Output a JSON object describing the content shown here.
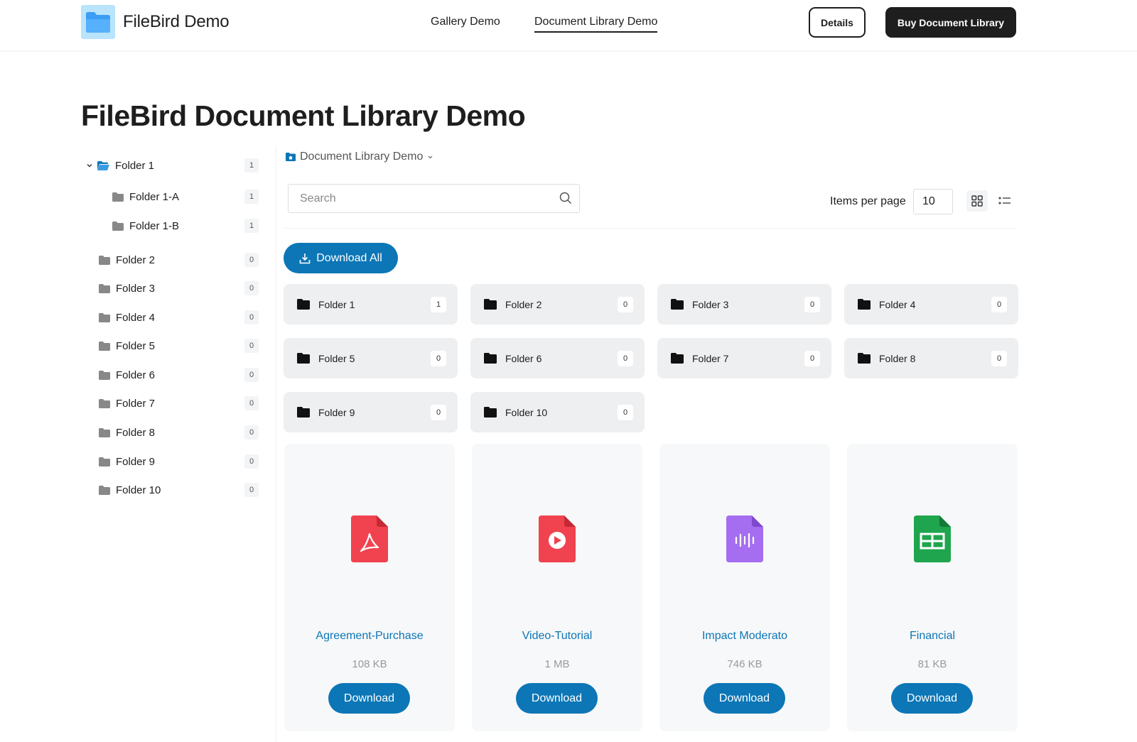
{
  "header": {
    "brand": "FileBird Demo",
    "nav": [
      "Gallery Demo",
      "Document Library Demo"
    ],
    "details_label": "Details",
    "buy_label": "Buy Document Library"
  },
  "page_title": "FileBird Document Library Demo",
  "sidebar": {
    "items": [
      {
        "label": "Folder 1",
        "count": "1"
      },
      {
        "label": "Folder 1-A",
        "count": "1"
      },
      {
        "label": "Folder 1-B",
        "count": "1"
      },
      {
        "label": "Folder 2",
        "count": "0"
      },
      {
        "label": "Folder 3",
        "count": "0"
      },
      {
        "label": "Folder 4",
        "count": "0"
      },
      {
        "label": "Folder 5",
        "count": "0"
      },
      {
        "label": "Folder 6",
        "count": "0"
      },
      {
        "label": "Folder 7",
        "count": "0"
      },
      {
        "label": "Folder 8",
        "count": "0"
      },
      {
        "label": "Folder 9",
        "count": "0"
      },
      {
        "label": "Folder 10",
        "count": "0"
      }
    ]
  },
  "toolbar": {
    "breadcrumb": "Document Library Demo",
    "search_placeholder": "Search",
    "items_per_page_label": "Items per page",
    "items_per_page_value": "10",
    "download_all_label": "Download All"
  },
  "folders": [
    {
      "label": "Folder 1",
      "count": "1"
    },
    {
      "label": "Folder 2",
      "count": "0"
    },
    {
      "label": "Folder 3",
      "count": "0"
    },
    {
      "label": "Folder 4",
      "count": "0"
    },
    {
      "label": "Folder 5",
      "count": "0"
    },
    {
      "label": "Folder 6",
      "count": "0"
    },
    {
      "label": "Folder 7",
      "count": "0"
    },
    {
      "label": "Folder 8",
      "count": "0"
    },
    {
      "label": "Folder 9",
      "count": "0"
    },
    {
      "label": "Folder 10",
      "count": "0"
    }
  ],
  "files": [
    {
      "name": "Agreement-Purchase",
      "size": "108 KB",
      "icon": "pdf-file-icon",
      "color": "#f0434f",
      "download_label": "Download"
    },
    {
      "name": "Video-Tutorial",
      "size": "1 MB",
      "icon": "video-file-icon",
      "color": "#f0434f",
      "download_label": "Download"
    },
    {
      "name": "Impact Moderato",
      "size": "746 KB",
      "icon": "audio-file-icon",
      "color": "#a56ef0",
      "download_label": "Download"
    },
    {
      "name": "Financial",
      "size": "81 KB",
      "icon": "spreadsheet-file-icon",
      "color": "#1fa54d",
      "download_label": "Download"
    }
  ],
  "colors": {
    "accent": "#0c76b6",
    "dark": "#1e1e1e"
  }
}
